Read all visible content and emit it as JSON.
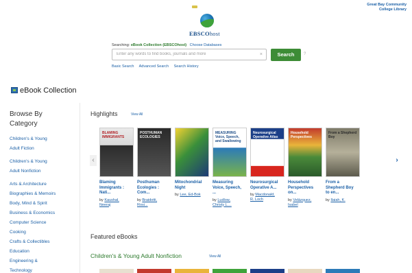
{
  "institution": {
    "line1": "Great Bay Community",
    "line2": "College Library"
  },
  "logo": {
    "brand_main": "EBSCO",
    "brand_sub": "host"
  },
  "search": {
    "searching_label": "Searching:",
    "collection": "eBook Collection (EBSCOhost)",
    "choose_databases": "Choose Databases",
    "placeholder": "Enter any words to find books, journals and more",
    "clear_glyph": "×",
    "button_label": "Search",
    "help_glyph": "?",
    "links": [
      "Basic Search",
      "Advanced Search",
      "Search History"
    ]
  },
  "page": {
    "heading": "eBook Collection"
  },
  "sidebar": {
    "title_line1": "Browse By",
    "title_line2": "Category",
    "categories": [
      "Children's & Young",
      "Adult Fiction",
      "Children's & Young",
      "Adult Nonfiction",
      "Arts & Architecture",
      "Biographies & Memoirs",
      "Body, Mind & Spirit",
      "Business & Economics",
      "Computer Science",
      "Cooking",
      "Crafts & Collectibles",
      "Education",
      "Engineering &",
      "Technology"
    ]
  },
  "highlights": {
    "title": "Highlights",
    "view_all": "View All",
    "prev_glyph": "‹",
    "next_glyph": "›",
    "books": [
      {
        "cover_text": "BLAMING IMMIGRANTS",
        "title_l1": "Blaming",
        "title_l2": "Immigrants :",
        "title_l3": "Nati...",
        "by": "by",
        "author_l1": "Kaushal,",
        "author_l2": "Neeraj"
      },
      {
        "cover_text": "POSTHUMAN ECOLOGIES",
        "title_l1": "Posthuman",
        "title_l2": "Ecologies :",
        "title_l3": "Com...",
        "by": "by",
        "author_l1": "Braidotti,",
        "author_l2": "Rosi..."
      },
      {
        "cover_text": "",
        "title_l1": "Mitochondrial",
        "title_l2": "Night",
        "title_l3": "",
        "by": "by",
        "author_l1": "Lee, Ed-Bok",
        "author_l2": ""
      },
      {
        "cover_text": "MEASURING Voice, Speech, and Swallowing",
        "title_l1": "Measuring",
        "title_l2": "Voice, Speech,",
        "title_l3": "...",
        "by": "by",
        "author_l1": "Ludlow,",
        "author_l2": "Christy L...."
      },
      {
        "cover_text": "Neurosurgical Operative Atlas",
        "title_l1": "Neurosurgical",
        "title_l2": "Operative A...",
        "title_l3": "",
        "by": "by",
        "author_l1": "Macdonald,",
        "author_l2": "R. Loch"
      },
      {
        "cover_text": "Household Perspectives",
        "title_l1": "Household",
        "title_l2": "Perspectives",
        "title_l3": "on...",
        "by": "by",
        "author_l1": "Velázquez,",
        "author_l2": "Isabel"
      },
      {
        "cover_text": "From a Shepherd Boy",
        "title_l1": "From a",
        "title_l2": "Shepherd Boy",
        "title_l3": "to en...",
        "by": "by",
        "author_l1": "Ilaiah, K.",
        "author_l2": ""
      }
    ]
  },
  "featured": {
    "title": "Featured eBooks",
    "subtitle": "Children's & Young Adult Nonfiction",
    "view_all": "View All"
  }
}
